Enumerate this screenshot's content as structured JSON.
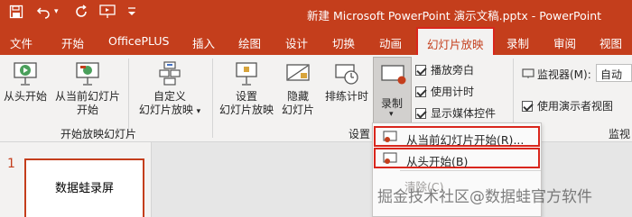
{
  "window": {
    "title": "新建 Microsoft PowerPoint 演示文稿.pptx  -  PowerPoint"
  },
  "tabs": [
    {
      "label": "文件"
    },
    {
      "label": "开始"
    },
    {
      "label": "OfficePLUS"
    },
    {
      "label": "插入"
    },
    {
      "label": "绘图"
    },
    {
      "label": "设计"
    },
    {
      "label": "切换"
    },
    {
      "label": "动画"
    },
    {
      "label": "幻灯片放映",
      "active": true
    },
    {
      "label": "录制"
    },
    {
      "label": "审阅"
    },
    {
      "label": "视图"
    }
  ],
  "ribbon": {
    "start_group": {
      "from_beginning": "从头开始",
      "from_current_line1": "从当前幻灯片",
      "from_current_line2": "开始",
      "custom_line1": "自定义",
      "custom_line2": "幻灯片放映",
      "label": "开始放映幻灯片"
    },
    "setup_group": {
      "setup_line1": "设置",
      "setup_line2": "幻灯片放映",
      "hide_line1": "隐藏",
      "hide_line2": "幻灯片",
      "rehearse": "排练计时",
      "record": "录制",
      "label": "设置",
      "checkboxes": [
        "播放旁白",
        "使用计时",
        "显示媒体控件"
      ]
    },
    "monitor_group": {
      "monitor_label": "监视器(M):",
      "monitor_value": "自动",
      "presenter_view": "使用演示者视图",
      "label": "监视"
    }
  },
  "slides": {
    "number": "1",
    "thumb_text": "数据蛙录屏"
  },
  "record_menu": {
    "items": [
      {
        "label": "从当前幻灯片开始(R)...",
        "highlighted": true
      },
      {
        "label": "从头开始(B)",
        "highlighted": true
      },
      {
        "label": "清除(C)",
        "disabled": true
      }
    ]
  },
  "watermark": "掘金技术社区@数据蛙官方软件",
  "colors": {
    "accent": "#c43e1c",
    "highlight_border": "#d9261c"
  }
}
